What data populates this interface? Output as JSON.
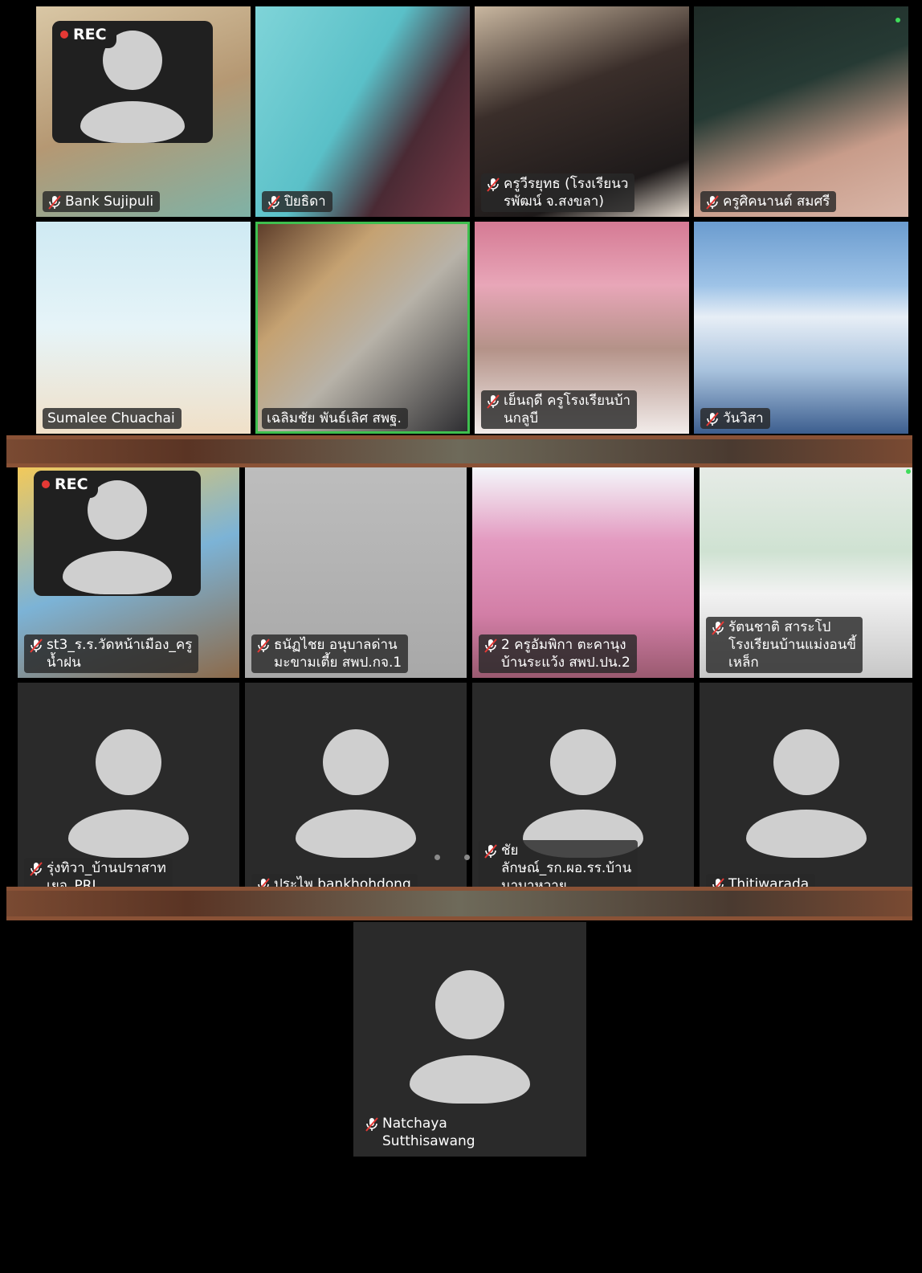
{
  "recording": {
    "label": "REC",
    "color": "#e53935"
  },
  "active_speaker_color": "#3fbf4f",
  "icons": {
    "muted_mic": "muted-mic-icon",
    "avatar": "person-avatar-icon"
  },
  "screen1": {
    "tiles": [
      {
        "name": "Bank Sujipuli",
        "muted": true
      },
      {
        "name": "ปิยธิดา",
        "muted": true
      },
      {
        "name": "ครูวีรยุทธ (โรงเรียนว\nรพัฒน์ จ.สงขลา)",
        "muted": true
      },
      {
        "name": "ครูศิคนานต์ สมศรี",
        "muted": true
      },
      {
        "name": "Sumalee Chuachai",
        "muted": false
      },
      {
        "name": "เฉลิมชัย พันธ์เลิศ สพฐ.",
        "muted": false,
        "active": true
      },
      {
        "name": "เย็นฤดี ครูโรงเรียนบ้า\nนกลูบี",
        "muted": true
      },
      {
        "name": "วันวิสา",
        "muted": true
      }
    ]
  },
  "screen2": {
    "tiles": [
      {
        "name": "st3_ร.ร.วัดหน้าเมือง_ครู\nน้ำฝน",
        "muted": true
      },
      {
        "name": "ธนัฏไชย อนุบาลด่าน\nมะขามเตี้ย สพป.กจ.1",
        "muted": true
      },
      {
        "name": "2  ครูอัมพิกา ตะคานุง\nบ้านระแว้ง สพป.ปน.2",
        "muted": true
      },
      {
        "name": "รัตนชาติ สาระโป\nโรงเรียนบ้านแม่งอนขี้\nเหล็ก",
        "muted": true
      },
      {
        "name": "รุ่งทิวา_บ้านปราสาท\nเยอ_PRL",
        "muted": true
      },
      {
        "name": "ประไพ bankhohdong",
        "muted": true
      },
      {
        "name": "ชัย\nลักษณ์_รก.ผอ.รร.บ้าน\nนาบาหวาย",
        "muted": true
      },
      {
        "name": "Thitiwarada",
        "muted": true
      }
    ]
  },
  "screen3": {
    "tile": {
      "name": "Natchaya\nSutthisawang",
      "muted": true
    }
  }
}
